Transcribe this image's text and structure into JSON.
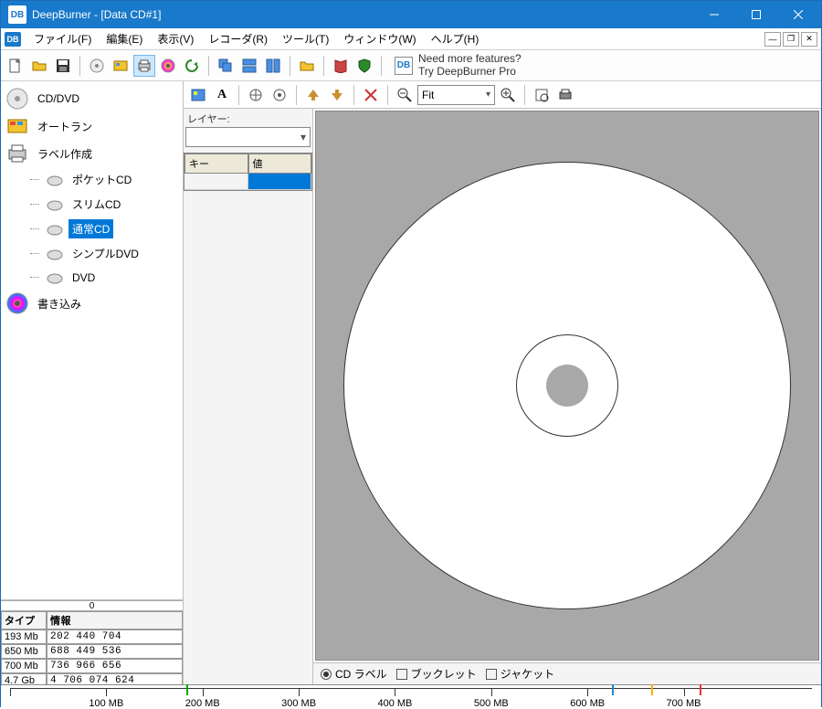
{
  "window": {
    "title": "DeepBurner - [Data CD#1]",
    "logo_text": "DB"
  },
  "menu": [
    "ファイル(F)",
    "編集(E)",
    "表示(V)",
    "レコーダ(R)",
    "ツール(T)",
    "ウィンドウ(W)",
    "ヘルプ(H)"
  ],
  "promo": {
    "line1": "Need more features?",
    "line2": "Try DeepBurner Pro"
  },
  "sidebar_tree": {
    "cd_dvd": "CD/DVD",
    "autorun": "オートラン",
    "label_create": "ラベル作成",
    "pocket_cd": "ポケットCD",
    "slim_cd": "スリムCD",
    "normal_cd": "通常CD",
    "simple_dvd": "シンプルDVD",
    "dvd": "DVD",
    "burn": "書き込み"
  },
  "capacity": {
    "scale_label": "0",
    "col_type": "タイプ",
    "col_info": "情報",
    "rows": [
      {
        "type": "193 Mb",
        "info": "202 440 704"
      },
      {
        "type": "650 Mb",
        "info": "688 449 536"
      },
      {
        "type": "700 Mb",
        "info": "736 966 656"
      },
      {
        "type": "4.7 Gb",
        "info": "4 706 074 624"
      }
    ]
  },
  "layer_panel": {
    "label": "レイヤー:",
    "col_key": "キー",
    "col_value": "値"
  },
  "zoom": {
    "selected": "Fit"
  },
  "bottom_tabs": {
    "cd_label": "CD ラベル",
    "booklet": "ブックレット",
    "jacket": "ジャケット"
  },
  "ruler_labels": [
    "100 MB",
    "200 MB",
    "300 MB",
    "400 MB",
    "500 MB",
    "600 MB",
    "700 MB"
  ]
}
